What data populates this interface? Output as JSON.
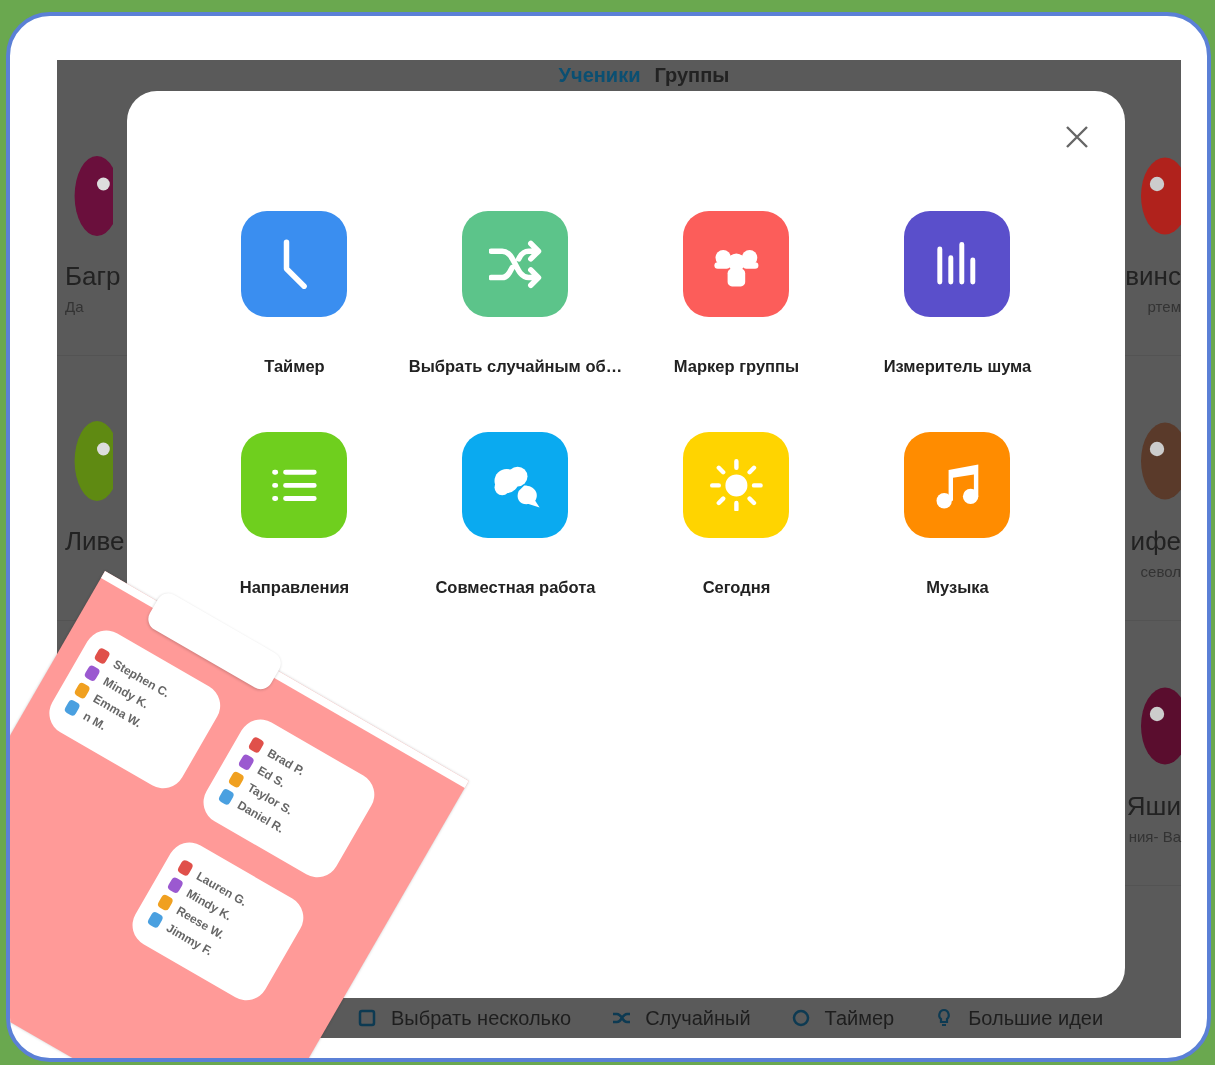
{
  "tabs": [
    {
      "label": "Ученики",
      "selected": true
    },
    {
      "label": "Группы",
      "selected": false
    }
  ],
  "left_students": [
    {
      "name": "Багр",
      "subname": "Да"
    },
    {
      "name": "Ливе"
    }
  ],
  "right_students": [
    {
      "name": "винс",
      "subname": "ртем"
    },
    {
      "name": "ифе",
      "subname": "севол"
    },
    {
      "name": "Яши",
      "subname": "ния- Ва"
    }
  ],
  "toolkit": {
    "tools": [
      {
        "label": "Таймер",
        "kind": "clock",
        "color": "#3a8ef0"
      },
      {
        "label": "Выбрать случайным об…",
        "kind": "shuffle",
        "color": "#5cc48a"
      },
      {
        "label": "Маркер группы",
        "kind": "group",
        "color": "#fc5d5a"
      },
      {
        "label": "Измеритель шума",
        "kind": "bars",
        "color": "#5a4fcb"
      },
      {
        "label": "Направления",
        "kind": "list",
        "color": "#6fcf1e"
      },
      {
        "label": "Совместная работа",
        "kind": "chat",
        "color": "#0aaaf0"
      },
      {
        "label": "Сегодня",
        "kind": "sun",
        "color": "#ffd400"
      },
      {
        "label": "Музыка",
        "kind": "music",
        "color": "#ff8c00"
      }
    ]
  },
  "toolbar": [
    {
      "label": "Выбрать несколько",
      "kind": "select"
    },
    {
      "label": "Случайный",
      "kind": "shuffle"
    },
    {
      "label": "Таймер",
      "kind": "clock"
    },
    {
      "label": "Большие идеи",
      "kind": "bulb"
    }
  ],
  "group_preview": {
    "groups": [
      {
        "members": [
          "Stephen C.",
          "Mindy K.",
          "Emma W.",
          "n M."
        ]
      },
      {
        "members": [
          "Brad P.",
          "Ed S.",
          "Taylor S.",
          "Daniel R."
        ]
      },
      {
        "members": [
          "Lauren G.",
          "Mindy K.",
          "Reese W.",
          "Jimmy F."
        ]
      }
    ]
  }
}
